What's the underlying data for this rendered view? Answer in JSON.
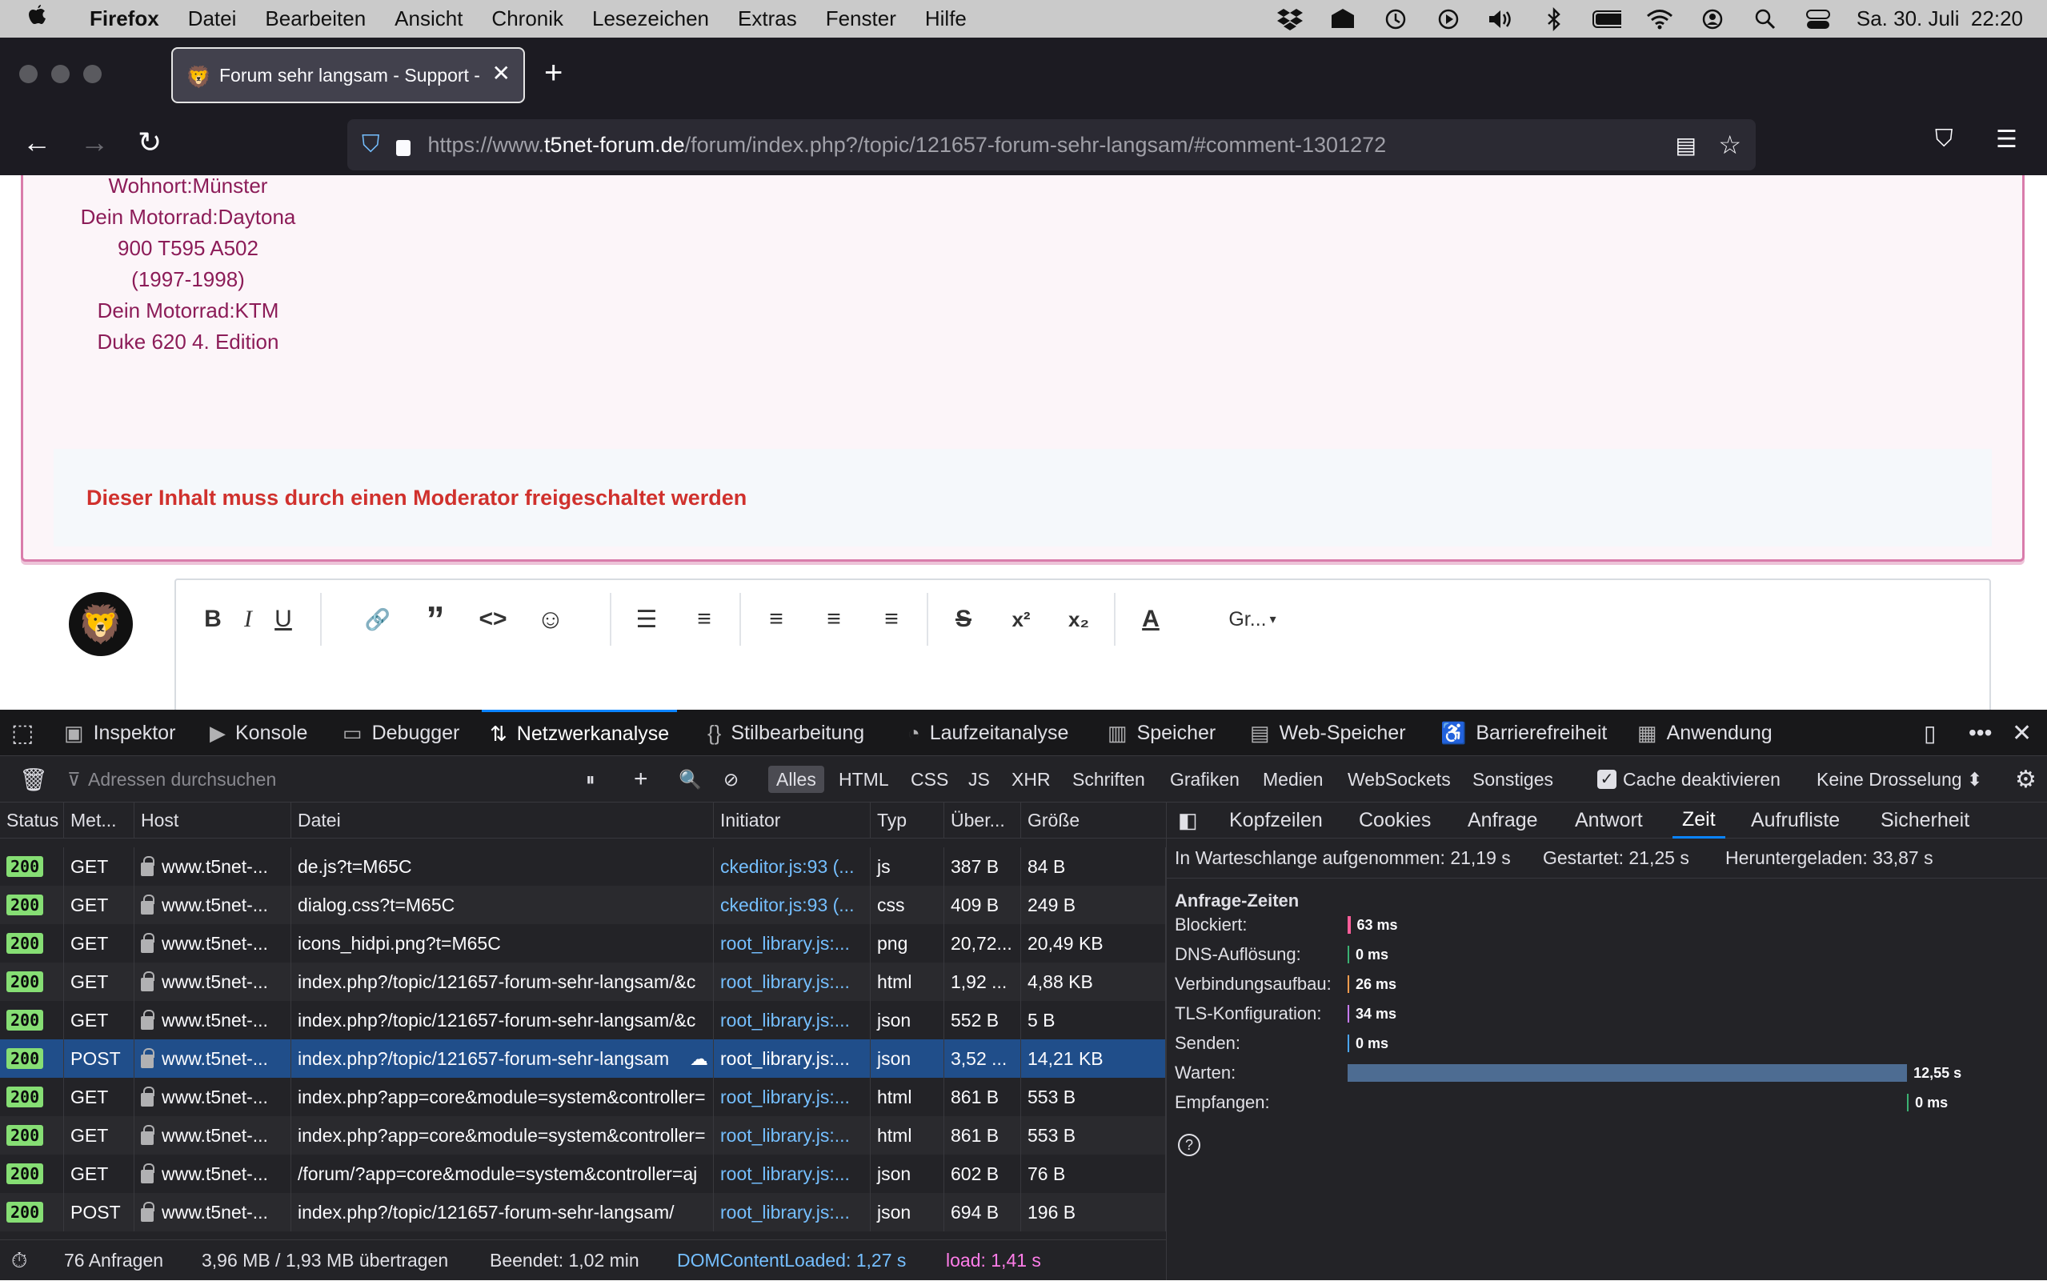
{
  "menubar": {
    "apple": "",
    "app": "Firefox",
    "items": [
      "Datei",
      "Bearbeiten",
      "Ansicht",
      "Chronik",
      "Lesezeichen",
      "Extras",
      "Fenster",
      "Hilfe"
    ],
    "datetime": "Sa. 30. Juli  22:20"
  },
  "browser": {
    "tab_title": "Forum sehr langsam - Support -",
    "url_prefix": "https://www.",
    "url_host": "t5net-forum.de",
    "url_path": "/forum/index.php?/topic/121657-forum-sehr-langsam/#comment-1301272"
  },
  "page": {
    "user_info": [
      "Wohnort:Münster",
      "Dein Motorrad:Daytona",
      "900 T595 A502",
      "(1997-1998)",
      "Dein Motorrad:KTM",
      "Duke 620 4. Edition"
    ],
    "moderation_notice": "Dieser Inhalt muss durch einen Moderator freigeschaltet werden",
    "editor": {
      "bold": "B",
      "italic": "I",
      "underline": "U",
      "link": "🔗",
      "quote": "”",
      "code": "<>",
      "emoji": "☺",
      "bullets": "☰",
      "numbers": "≡",
      "align_left": "≡",
      "align_center": "≡",
      "align_right": "≡",
      "strike": "S",
      "superscript": "x²",
      "subscript": "x₂",
      "fontcolor": "A",
      "fontsize": "Gr..."
    }
  },
  "devtools": {
    "tabs": [
      "Inspektor",
      "Konsole",
      "Debugger",
      "Netzwerkanalyse",
      "Stilbearbeitung",
      "Laufzeitanalyse",
      "Speicher",
      "Web-Speicher",
      "Barrierefreiheit",
      "Anwendung"
    ],
    "filter_placeholder": "Adressen durchsuchen",
    "filters": [
      "Alles",
      "HTML",
      "CSS",
      "JS",
      "XHR",
      "Schriften",
      "Grafiken",
      "Medien",
      "WebSockets",
      "Sonstiges"
    ],
    "cache_label": "Cache deaktivieren",
    "throttle": "Keine Drosselung ⬍",
    "columns": [
      "Status",
      "Met...",
      "Host",
      "Datei",
      "Initiator",
      "Typ",
      "Über...",
      "Größe"
    ],
    "rows": [
      {
        "status": "200",
        "method": "GET",
        "host": "www.t5net-...",
        "file": "de.js?t=M65C",
        "initiator": "ckeditor.js:93 (...",
        "type": "js",
        "transferred": "387 B",
        "size": "84 B"
      },
      {
        "status": "200",
        "method": "GET",
        "host": "www.t5net-...",
        "file": "dialog.css?t=M65C",
        "initiator": "ckeditor.js:93 (...",
        "type": "css",
        "transferred": "409 B",
        "size": "249 B"
      },
      {
        "status": "200",
        "method": "GET",
        "host": "www.t5net-...",
        "file": "icons_hidpi.png?t=M65C",
        "initiator": "root_library.js:...",
        "type": "png",
        "transferred": "20,72...",
        "size": "20,49 KB"
      },
      {
        "status": "200",
        "method": "GET",
        "host": "www.t5net-...",
        "file": "index.php?/topic/121657-forum-sehr-langsam/&c",
        "initiator": "root_library.js:...",
        "type": "html",
        "transferred": "1,92 ...",
        "size": "4,88 KB"
      },
      {
        "status": "200",
        "method": "GET",
        "host": "www.t5net-...",
        "file": "index.php?/topic/121657-forum-sehr-langsam/&c",
        "initiator": "root_library.js:...",
        "type": "json",
        "transferred": "552 B",
        "size": "5 B"
      },
      {
        "status": "200",
        "method": "POST",
        "host": "www.t5net-...",
        "file": "index.php?/topic/121657-forum-sehr-langsam",
        "initiator": "root_library.js:...",
        "type": "json",
        "transferred": "3,52 ...",
        "size": "14,21 KB"
      },
      {
        "status": "200",
        "method": "GET",
        "host": "www.t5net-...",
        "file": "index.php?app=core&module=system&controller=",
        "initiator": "root_library.js:...",
        "type": "html",
        "transferred": "861 B",
        "size": "553 B"
      },
      {
        "status": "200",
        "method": "GET",
        "host": "www.t5net-...",
        "file": "index.php?app=core&module=system&controller=",
        "initiator": "root_library.js:...",
        "type": "html",
        "transferred": "861 B",
        "size": "553 B"
      },
      {
        "status": "200",
        "method": "GET",
        "host": "www.t5net-...",
        "file": "/forum/?app=core&module=system&controller=aj",
        "initiator": "root_library.js:...",
        "type": "json",
        "transferred": "602 B",
        "size": "76 B"
      },
      {
        "status": "200",
        "method": "POST",
        "host": "www.t5net-...",
        "file": "index.php?/topic/121657-forum-sehr-langsam/",
        "initiator": "root_library.js:...",
        "type": "json",
        "transferred": "694 B",
        "size": "196 B"
      }
    ],
    "statusbar": {
      "requests": "76 Anfragen",
      "transferred": "3,96 MB / 1,93 MB übertragen",
      "finished": "Beendet: 1,02 min",
      "dcl": "DOMContentLoaded: 1,27 s",
      "load": "load: 1,41 s"
    },
    "panel_tabs": [
      "Kopfzeilen",
      "Cookies",
      "Anfrage",
      "Antwort",
      "Zeit",
      "Aufrufliste",
      "Sicherheit"
    ],
    "timing_summary": {
      "queued": "In Warteschlange aufgenommen: 21,19 s",
      "started": "Gestartet: 21,25 s",
      "downloaded": "Heruntergeladen: 33,87 s"
    },
    "timing_heading": "Anfrage-Zeiten",
    "timings": [
      {
        "label": "Blockiert:",
        "value": "63 ms",
        "color": "#ff5e9a"
      },
      {
        "label": "DNS-Auflösung:",
        "value": "0 ms",
        "color": "#3bb273"
      },
      {
        "label": "Verbindungsaufbau:",
        "value": "26 ms",
        "color": "#ff9d4d"
      },
      {
        "label": "TLS-Konfiguration:",
        "value": "34 ms",
        "color": "#c87bff"
      },
      {
        "label": "Senden:",
        "value": "0 ms",
        "color": "#4aa7ff"
      },
      {
        "label": "Warten:",
        "value": "12,55 s",
        "color": "#4d6c92"
      },
      {
        "label": "Empfangen:",
        "value": "0 ms",
        "color": "#3bb273"
      }
    ],
    "help": "?"
  }
}
